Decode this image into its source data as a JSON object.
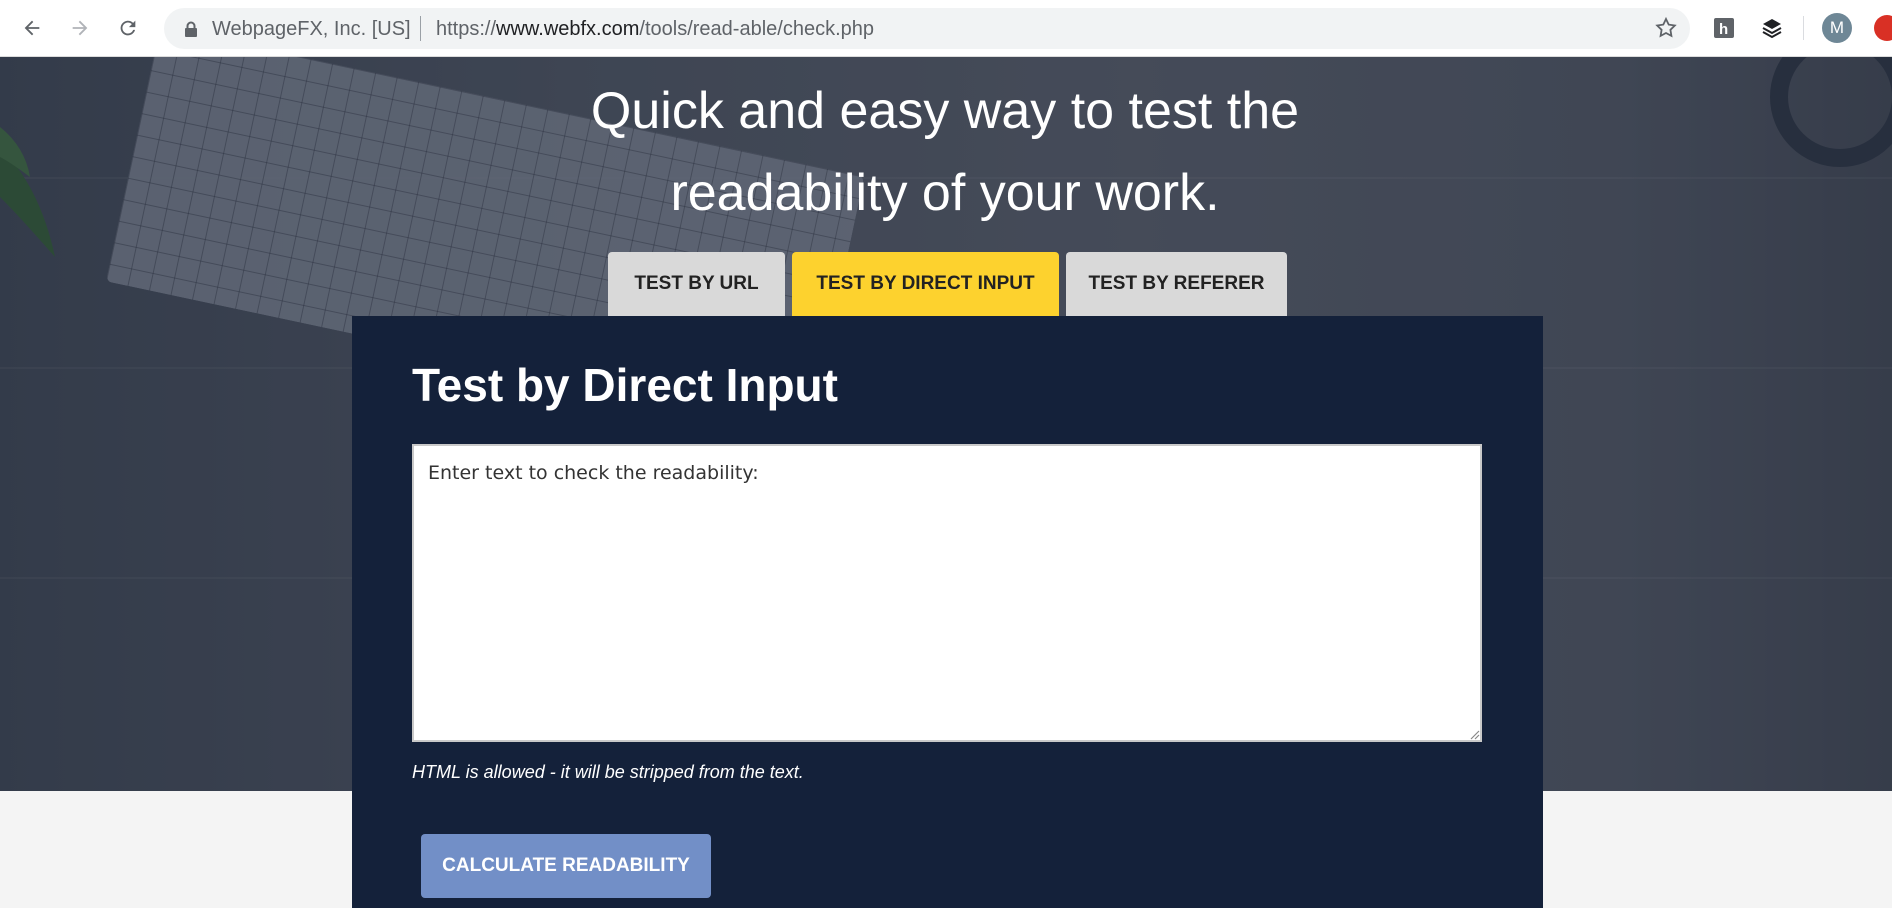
{
  "browser": {
    "site_name": "WebpageFX, Inc. [US]",
    "url_scheme": "https://",
    "url_host": "www.webfx.com",
    "url_path": "/tools/read-able/check.php",
    "profile_initial": "M"
  },
  "hero": {
    "headline_line1": "Quick and easy way to test the",
    "headline_line2": "readability of your work."
  },
  "tabs": [
    {
      "label": "TEST BY URL",
      "active": false
    },
    {
      "label": "TEST BY DIRECT INPUT",
      "active": true
    },
    {
      "label": "TEST BY REFERER",
      "active": false
    }
  ],
  "panel": {
    "title": "Test by Direct Input",
    "textarea_placeholder": "Enter text to check the readability:",
    "hint": "HTML is allowed - it will be stripped from the text.",
    "button_label": "CALCULATE READABILITY"
  },
  "colors": {
    "panel_bg": "#14213a",
    "tab_active": "#fdd22e",
    "tab_inactive": "#d9d9d9",
    "button_bg": "#728fc7"
  }
}
